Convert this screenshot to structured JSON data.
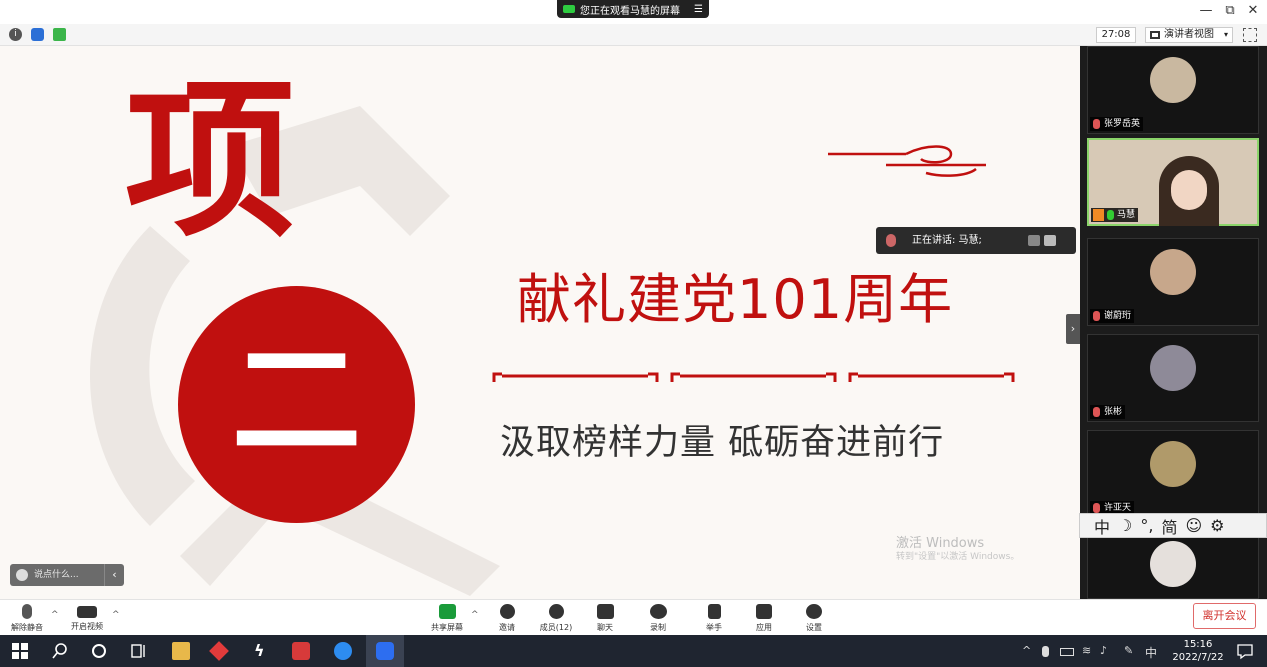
{
  "window": {
    "share_banner": "您正在观看马慧的屏幕",
    "share_menu": "☰",
    "minimize": "—",
    "restore": "⧉",
    "close": "✕"
  },
  "toolbar": {
    "timer": "27:08",
    "view_mode": "演讲者视图",
    "view_caret": "▾"
  },
  "slide": {
    "big_char": "项",
    "circle_char": "二",
    "title": "献礼建党101周年",
    "subtitle": "汲取榜样力量  砥砺奋进前行",
    "accent_color": "#c0100f"
  },
  "watermark": {
    "line1": "激活 Windows",
    "line2": "转到\"设置\"以激活 Windows。"
  },
  "comment": {
    "placeholder": "说点什么...",
    "arrow": "‹"
  },
  "speaking": {
    "label": "正在讲话: 马慧;"
  },
  "participants": [
    {
      "name": "张罗岳英",
      "mic": "off",
      "color": "#c9b8a0"
    },
    {
      "name": "马慧",
      "mic": "on",
      "color": "#d7c9b6",
      "active": true
    },
    {
      "name": "谢蔚珩",
      "mic": "off",
      "color": "#c7a78b"
    },
    {
      "name": "张彬",
      "mic": "off",
      "color": "#8e8a98"
    },
    {
      "name": "许亚天",
      "mic": "off",
      "color": "#b09a6a"
    },
    {
      "name": "",
      "mic": "off",
      "color": "#e5e0dc"
    }
  ],
  "panel_handle": "›",
  "ime": [
    "中",
    "☽",
    "°,",
    "简",
    "☺",
    "⚙"
  ],
  "meeting_bar": {
    "mute": "解除静音",
    "video": "开启视频",
    "share": "共享屏幕",
    "invite": "邀请",
    "members": "成员(12)",
    "chat": "聊天",
    "record": "录制",
    "raise_hand": "举手",
    "apps": "应用",
    "settings": "设置",
    "leave": "离开会议",
    "caret": "^"
  },
  "taskbar": {
    "time": "15:16",
    "date": "2022/7/22",
    "ime": "中",
    "tray_caret": "^"
  }
}
